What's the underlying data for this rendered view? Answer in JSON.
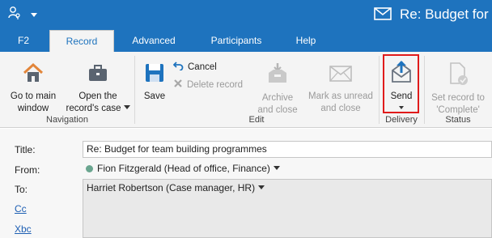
{
  "window": {
    "title": "Re: Budget for t",
    "title_icon": "envelope-icon",
    "quick_access": [
      "user-key-icon",
      "dropdown-caret-icon"
    ]
  },
  "tabs": [
    {
      "label": "F2",
      "active": false
    },
    {
      "label": "Record",
      "active": true
    },
    {
      "label": "Advanced",
      "active": false
    },
    {
      "label": "Participants",
      "active": false
    },
    {
      "label": "Help",
      "active": false
    }
  ],
  "ribbon": {
    "navigation": {
      "group_label": "Navigation",
      "go_to_main": {
        "line1": "Go to main",
        "line2": "window",
        "icon": "home-icon"
      },
      "open_case": {
        "line1": "Open the",
        "line2": "record's case",
        "icon": "briefcase-icon"
      }
    },
    "edit": {
      "group_label": "Edit",
      "save": {
        "label": "Save",
        "icon": "save-icon"
      },
      "cancel": {
        "label": "Cancel",
        "icon": "undo-icon"
      },
      "delete_record": {
        "label": "Delete record",
        "icon": "delete-x-icon"
      },
      "archive": {
        "line1": "Archive",
        "line2": "and close",
        "icon": "archive-icon"
      },
      "mark_unread": {
        "line1": "Mark as unread",
        "line2": "and close",
        "icon": "envelope-closed-icon"
      }
    },
    "delivery": {
      "group_label": "Delivery",
      "send": {
        "label": "Send",
        "icon": "send-envelope-icon"
      }
    },
    "status": {
      "group_label": "Status",
      "set_complete": {
        "line1": "Set record to",
        "line2": "'Complete'",
        "icon": "document-check-icon"
      }
    }
  },
  "form": {
    "title": {
      "label": "Title:",
      "value": "Re: Budget for team building programmes"
    },
    "from": {
      "label": "From:",
      "value": "Fion Fitzgerald (Head of office, Finance)"
    },
    "to": {
      "label": "To:",
      "value": "Harriet Robertson (Case manager, HR)"
    },
    "cc": {
      "label": "Cc"
    },
    "bcc": {
      "label": "Xbc"
    }
  },
  "colors": {
    "titlebar": "#1e73be",
    "ribbon_bg": "#f4f4f4",
    "highlight_border": "#e01b1b",
    "link": "#1e5fb3"
  }
}
